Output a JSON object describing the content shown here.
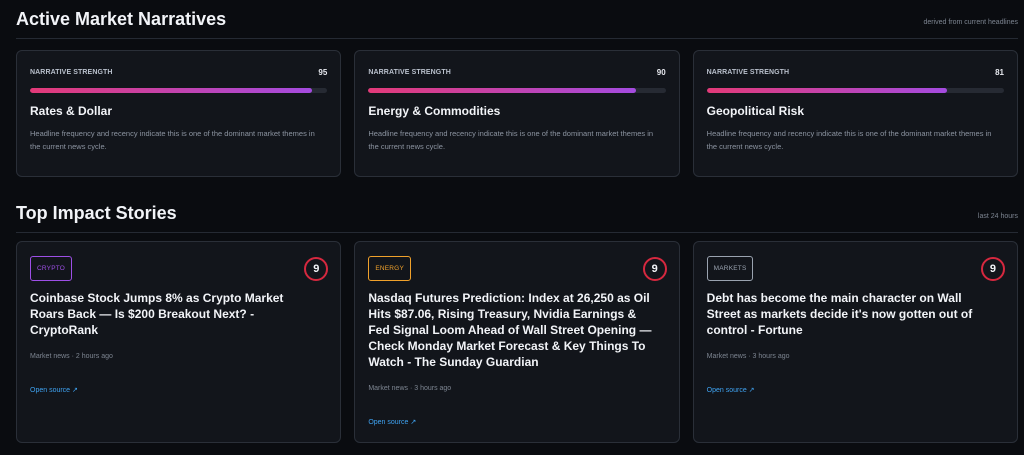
{
  "narratives": {
    "title": "Active Market Narratives",
    "note": "derived from current headlines",
    "cards": [
      {
        "label": "NARRATIVE STRENGTH",
        "score": "95",
        "strength": 95,
        "title": "Rates & Dollar",
        "description": "Headline frequency and recency indicate this is one of the dominant market themes in the current news cycle."
      },
      {
        "label": "NARRATIVE STRENGTH",
        "score": "90",
        "strength": 90,
        "title": "Energy & Commodities",
        "description": "Headline frequency and recency indicate this is one of the dominant market themes in the current news cycle."
      },
      {
        "label": "NARRATIVE STRENGTH",
        "score": "81",
        "strength": 81,
        "title": "Geopolitical Risk",
        "description": "Headline frequency and recency indicate this is one of the dominant market themes in the current news cycle."
      }
    ]
  },
  "stories": {
    "title": "Top Impact Stories",
    "note": "last 24 hours",
    "cards": [
      {
        "tag": "CRYPTO",
        "tag_color": "#9d4fe6",
        "impact": "9",
        "title": "Coinbase Stock Jumps 8% as Crypto Market Roars Back — Is $200 Breakout Next? - CryptoRank",
        "meta": "Market news · 2 hours ago",
        "link": "Open source ↗"
      },
      {
        "tag": "ENERGY",
        "tag_color": "#f0a12b",
        "impact": "9",
        "title": "Nasdaq Futures Prediction: Index at 26,250 as Oil Hits $87.06, Rising Treasury, Nvidia Earnings & Fed Signal Loom Ahead of Wall Street Opening — Check Monday Market Forecast & Key Things To Watch - The Sunday Guardian",
        "meta": "Market news · 3 hours ago",
        "link": "Open source ↗"
      },
      {
        "tag": "MARKETS",
        "tag_color": "#9aa3b0",
        "impact": "9",
        "title": "Debt has become the main character on Wall Street as markets decide it's now gotten out of control - Fortune",
        "meta": "Market news · 3 hours ago",
        "link": "Open source ↗"
      }
    ]
  },
  "colors": {
    "impact_ring": "#d6283f",
    "bar_gradient_start": "#e33a78",
    "bar_gradient_end": "#a44be0",
    "link": "#3fa3f2"
  }
}
